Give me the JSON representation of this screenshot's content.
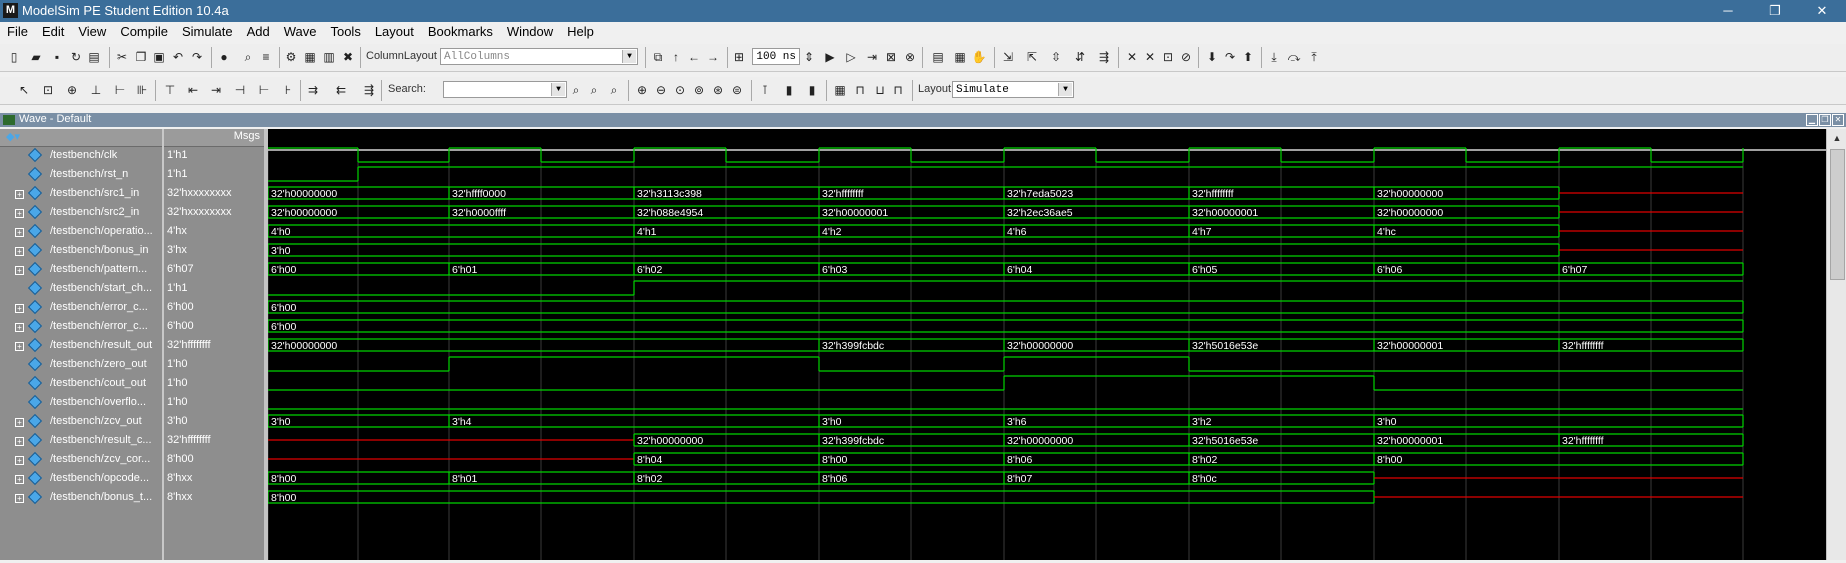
{
  "window": {
    "title": "ModelSim PE Student Edition 10.4a",
    "app_icon_letter": "M",
    "minimize_glyph": "─",
    "maximize_glyph": "❐",
    "close_glyph": "✕"
  },
  "menu": [
    "File",
    "Edit",
    "View",
    "Compile",
    "Simulate",
    "Add",
    "Wave",
    "Tools",
    "Layout",
    "Bookmarks",
    "Window",
    "Help"
  ],
  "toolbar1": {
    "column_layout_label": "ColumnLayout",
    "column_layout_value": "AllColumns",
    "run_length_value": "100",
    "run_length_unit": "ns"
  },
  "toolbar2": {
    "search_label": "Search:",
    "search_placeholder": "",
    "layout_label": "Layout",
    "layout_value": "Simulate"
  },
  "wave_window": {
    "title": "Wave - Default",
    "msgs_header": "Msgs"
  },
  "signals": [
    {
      "name": "/testbench/clk",
      "value": "1'h1",
      "expandable": false
    },
    {
      "name": "/testbench/rst_n",
      "value": "1'h1",
      "expandable": false
    },
    {
      "name": "/testbench/src1_in",
      "value": "32'hxxxxxxxx",
      "expandable": true
    },
    {
      "name": "/testbench/src2_in",
      "value": "32'hxxxxxxxx",
      "expandable": true
    },
    {
      "name": "/testbench/operatio...",
      "value": "4'hx",
      "expandable": true
    },
    {
      "name": "/testbench/bonus_in",
      "value": "3'hx",
      "expandable": true
    },
    {
      "name": "/testbench/pattern...",
      "value": "6'h07",
      "expandable": true
    },
    {
      "name": "/testbench/start_ch...",
      "value": "1'h1",
      "expandable": false
    },
    {
      "name": "/testbench/error_c...",
      "value": "6'h00",
      "expandable": true
    },
    {
      "name": "/testbench/error_c...",
      "value": "6'h00",
      "expandable": true
    },
    {
      "name": "/testbench/result_out",
      "value": "32'hffffffff",
      "expandable": true
    },
    {
      "name": "/testbench/zero_out",
      "value": "1'h0",
      "expandable": false
    },
    {
      "name": "/testbench/cout_out",
      "value": "1'h0",
      "expandable": false
    },
    {
      "name": "/testbench/overflo...",
      "value": "1'h0",
      "expandable": false
    },
    {
      "name": "/testbench/zcv_out",
      "value": "3'h0",
      "expandable": true
    },
    {
      "name": "/testbench/result_c...",
      "value": "32'hffffffff",
      "expandable": true
    },
    {
      "name": "/testbench/zcv_cor...",
      "value": "8'h00",
      "expandable": true
    },
    {
      "name": "/testbench/opcode...",
      "value": "8'hxx",
      "expandable": true
    },
    {
      "name": "/testbench/bonus_t...",
      "value": "8'hxx",
      "expandable": true
    }
  ],
  "bus_labels": {
    "src1_in": [
      "32'h00000000",
      "32'hffff0000",
      "32'h3113c398",
      "32'hffffffff",
      "32'h7eda5023",
      "32'hffffffff",
      "32'h00000000"
    ],
    "src2_in": [
      "32'h00000000",
      "32'h0000ffff",
      "32'h088e4954",
      "32'h00000001",
      "32'h2ec36ae5",
      "32'h00000001",
      "32'h00000000"
    ],
    "operation": [
      "4'h0",
      "4'h1",
      "4'h2",
      "4'h6",
      "4'h7",
      "4'hc"
    ],
    "bonus_in": [
      "3'h0"
    ],
    "pattern": [
      "6'h00",
      "6'h01",
      "6'h02",
      "6'h03",
      "6'h04",
      "6'h05",
      "6'h06",
      "6'h07"
    ],
    "error_c1": [
      "6'h00"
    ],
    "error_c2": [
      "6'h00"
    ],
    "result_out": [
      "32'h00000000",
      "32'h399fcbdc",
      "32'h00000000",
      "32'h5016e53e",
      "32'h00000001",
      "32'hffffffff"
    ],
    "zcv_out": [
      "3'h0",
      "3'h4",
      "3'h0",
      "3'h6",
      "3'h2",
      "3'h0"
    ],
    "result_c": [
      "32'h00000000",
      "32'h399fcbdc",
      "32'h00000000",
      "32'h5016e53e",
      "32'h00000001",
      "32'hffffffff"
    ],
    "zcv_cor": [
      "8'h04",
      "8'h00",
      "8'h06",
      "8'h02",
      "8'h00"
    ],
    "opcode": [
      "8'h00",
      "8'h01",
      "8'h02",
      "8'h06",
      "8'h07",
      "8'h0c"
    ],
    "bonus_t": [
      "8'h00"
    ]
  },
  "colors": {
    "wave_green": "#00d400",
    "wave_red": "#e00000",
    "wave_bg": "#000000",
    "panel_gray": "#8e8e8e",
    "title_blue": "#3b6e9a"
  }
}
